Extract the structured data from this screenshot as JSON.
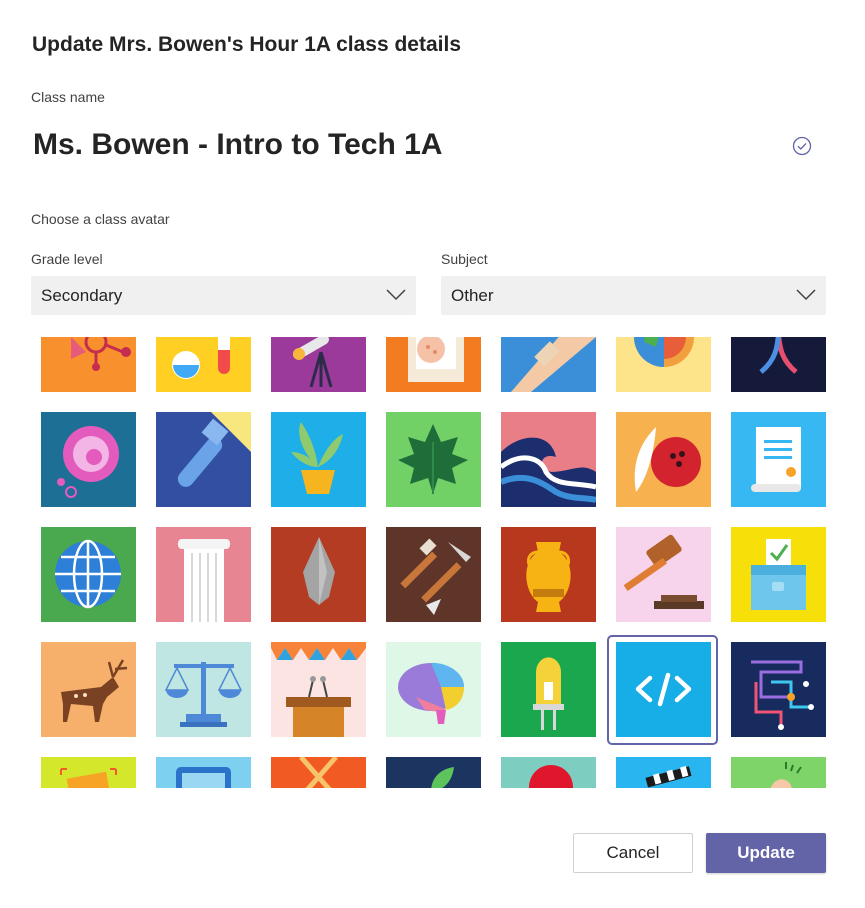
{
  "dialog": {
    "title": "Update Mrs. Bowen's Hour 1A class details",
    "class_name_label": "Class name",
    "class_name_value": "Ms. Bowen - Intro to Tech 1A",
    "avatar_label": "Choose a class avatar",
    "grade_label": "Grade level",
    "grade_value": "Secondary",
    "subject_label": "Subject",
    "subject_value": "Other",
    "cancel_label": "Cancel",
    "update_label": "Update"
  },
  "colors": {
    "accent": "#6264a7",
    "dropdown_bg": "#f0f0f0"
  },
  "avatars": [
    [
      "chemistry-molecule",
      "chemistry-flasks",
      "telescope",
      "bandage-frame",
      "bandaged-arm",
      "earth-layers",
      "dna-helix"
    ],
    [
      "cell",
      "flashlight",
      "potted-plant",
      "maple-leaf",
      "ocean-wave",
      "feather-bowling-ball",
      "scroll"
    ],
    [
      "globe",
      "greek-column",
      "arrowhead",
      "archaeology-tools",
      "greek-vase",
      "gavel",
      "ballot-box"
    ],
    [
      "cave-painting-deer",
      "scales-of-justice",
      "podium",
      "brain",
      "led-bulb",
      "code",
      "circuit-board"
    ],
    [
      "photo-frame",
      "tablet",
      "crossed-swords",
      "leaf",
      "red-circle",
      "clapperboard",
      "pointing-hand"
    ]
  ],
  "selected_avatar": "code"
}
